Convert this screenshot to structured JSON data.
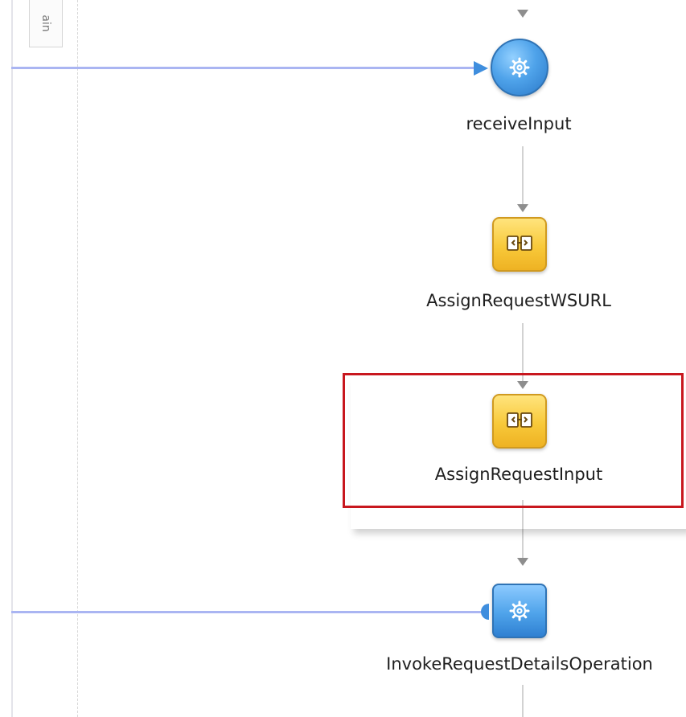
{
  "lane": {
    "tab_label": "ain"
  },
  "activities": [
    {
      "name": "receiveInput",
      "type": "receive",
      "icon": "gear-icon"
    },
    {
      "name": "AssignRequestWSURL",
      "type": "assign",
      "icon": "assign-icon"
    },
    {
      "name": "AssignRequestInput",
      "type": "assign",
      "icon": "assign-icon",
      "selected": true
    },
    {
      "name": "InvokeRequestDetailsOperation",
      "type": "invoke",
      "icon": "gear-icon"
    }
  ],
  "colors": {
    "selection_border": "#c8171e",
    "partner_link": "#aab5f2",
    "receive_blue": "#4fa3ea",
    "assign_yellow": "#f8c93a"
  }
}
